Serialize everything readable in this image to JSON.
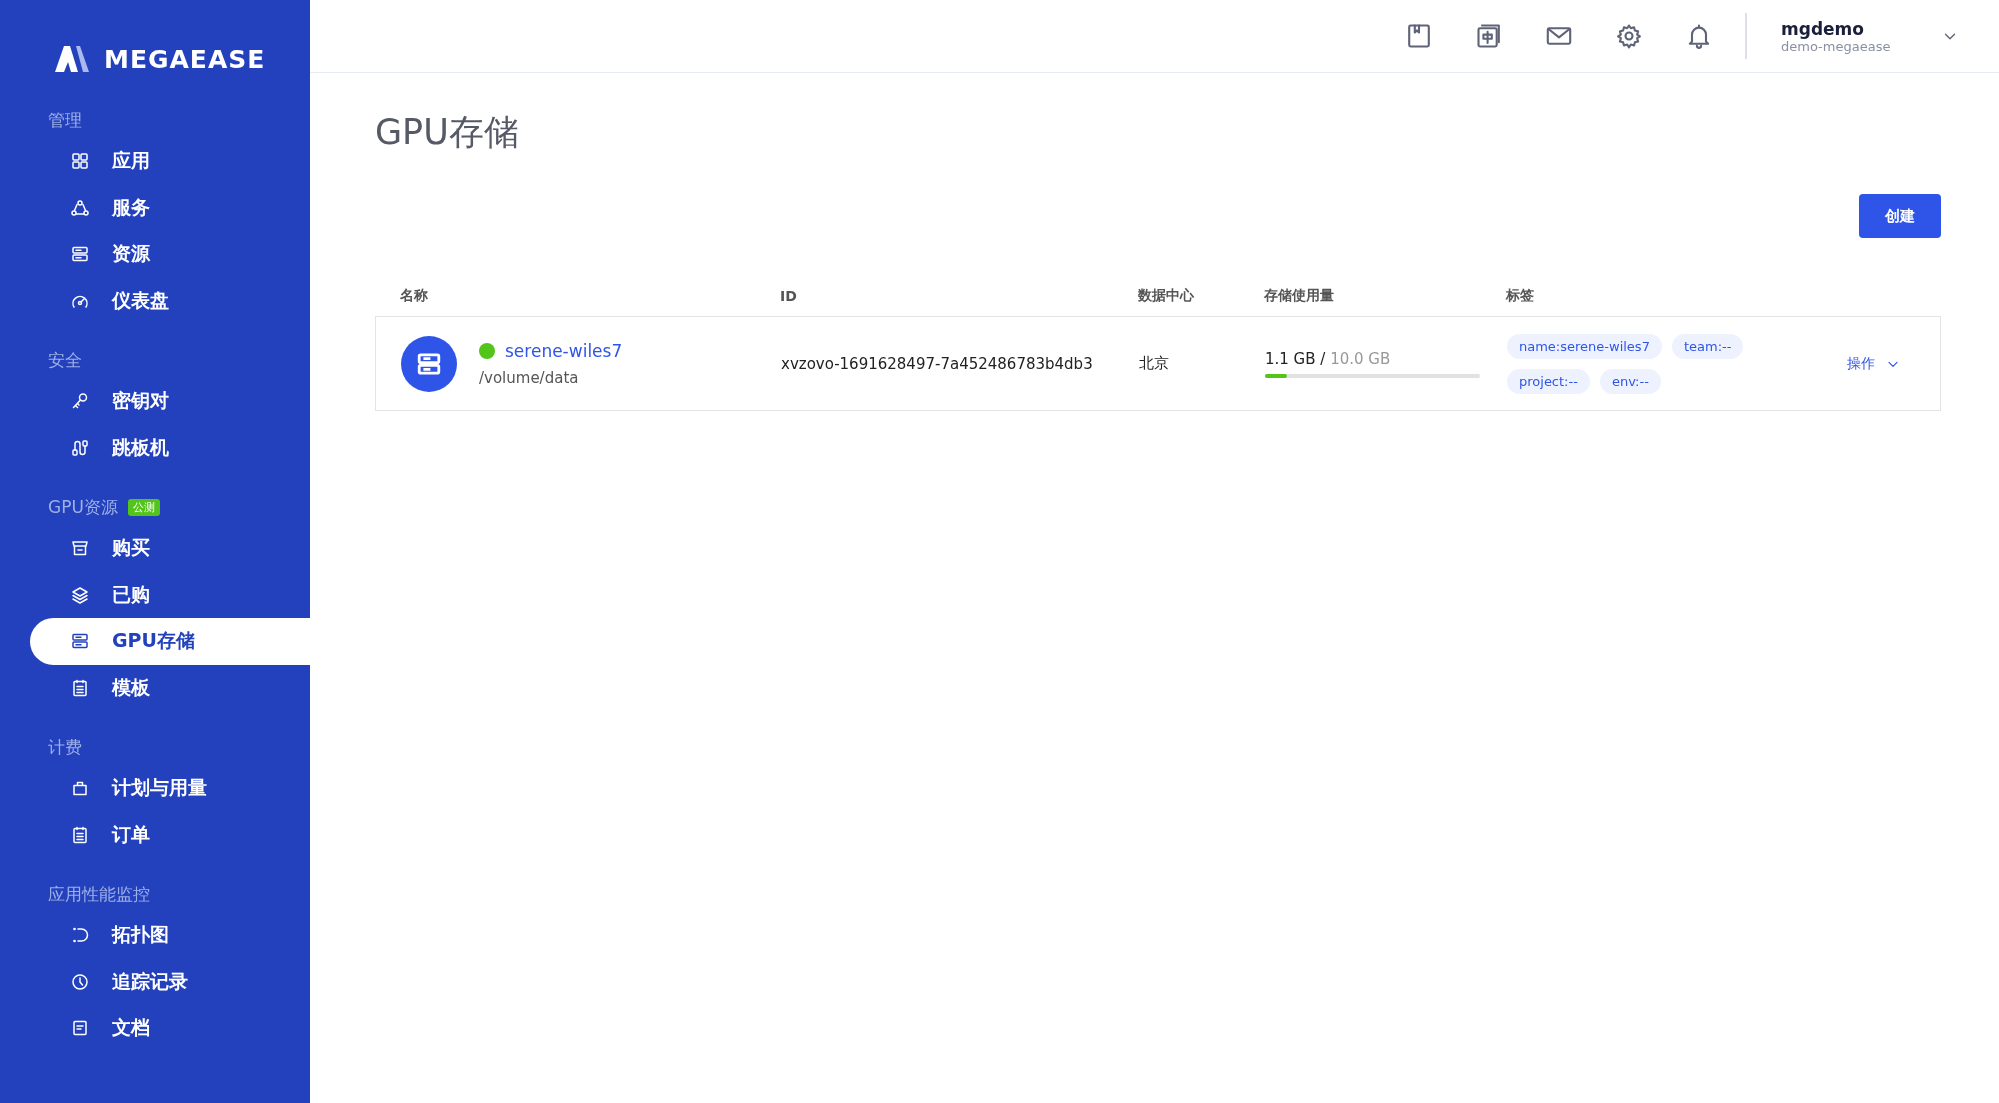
{
  "brand": {
    "name": "MEGAEASE"
  },
  "sidebar": {
    "sections": [
      {
        "title": "管理",
        "items": [
          {
            "label": "应用",
            "selected": false
          },
          {
            "label": "服务",
            "selected": false
          },
          {
            "label": "资源",
            "selected": false
          },
          {
            "label": "仪表盘",
            "selected": false
          }
        ]
      },
      {
        "title": "安全",
        "items": [
          {
            "label": "密钥对",
            "selected": false
          },
          {
            "label": "跳板机",
            "selected": false
          }
        ]
      },
      {
        "title": "GPU资源",
        "badge": "公测",
        "items": [
          {
            "label": "购买",
            "selected": false
          },
          {
            "label": "已购",
            "selected": false
          },
          {
            "label": "GPU存储",
            "selected": true
          },
          {
            "label": "模板",
            "selected": false
          }
        ]
      },
      {
        "title": "计费",
        "items": [
          {
            "label": "计划与用量",
            "selected": false
          },
          {
            "label": "订单",
            "selected": false
          }
        ]
      },
      {
        "title": "应用性能监控",
        "items": [
          {
            "label": "拓扑图",
            "selected": false
          },
          {
            "label": "追踪记录",
            "selected": false
          },
          {
            "label": "文档",
            "selected": false
          }
        ]
      }
    ]
  },
  "header": {
    "user": {
      "name": "mgdemo",
      "org": "demo-megaease"
    }
  },
  "page": {
    "title": "GPU存储",
    "create_button": "创建"
  },
  "table": {
    "columns": [
      "名称",
      "ID",
      "数据中心",
      "存储使用量",
      "标签"
    ],
    "rows": [
      {
        "name": "serene-wiles7",
        "color": "#52c41a",
        "path": "/volume/data",
        "id": "xvzovo-1691628497-7a452486783b4db3",
        "datacenter": "北京",
        "used": "1.1 GB",
        "separator": "/",
        "total": "10.0 GB",
        "level": 0.1,
        "tags": [
          "name:serene-wiles7",
          "team:--",
          "project:--",
          "env:--"
        ],
        "action": "操作"
      }
    ]
  }
}
